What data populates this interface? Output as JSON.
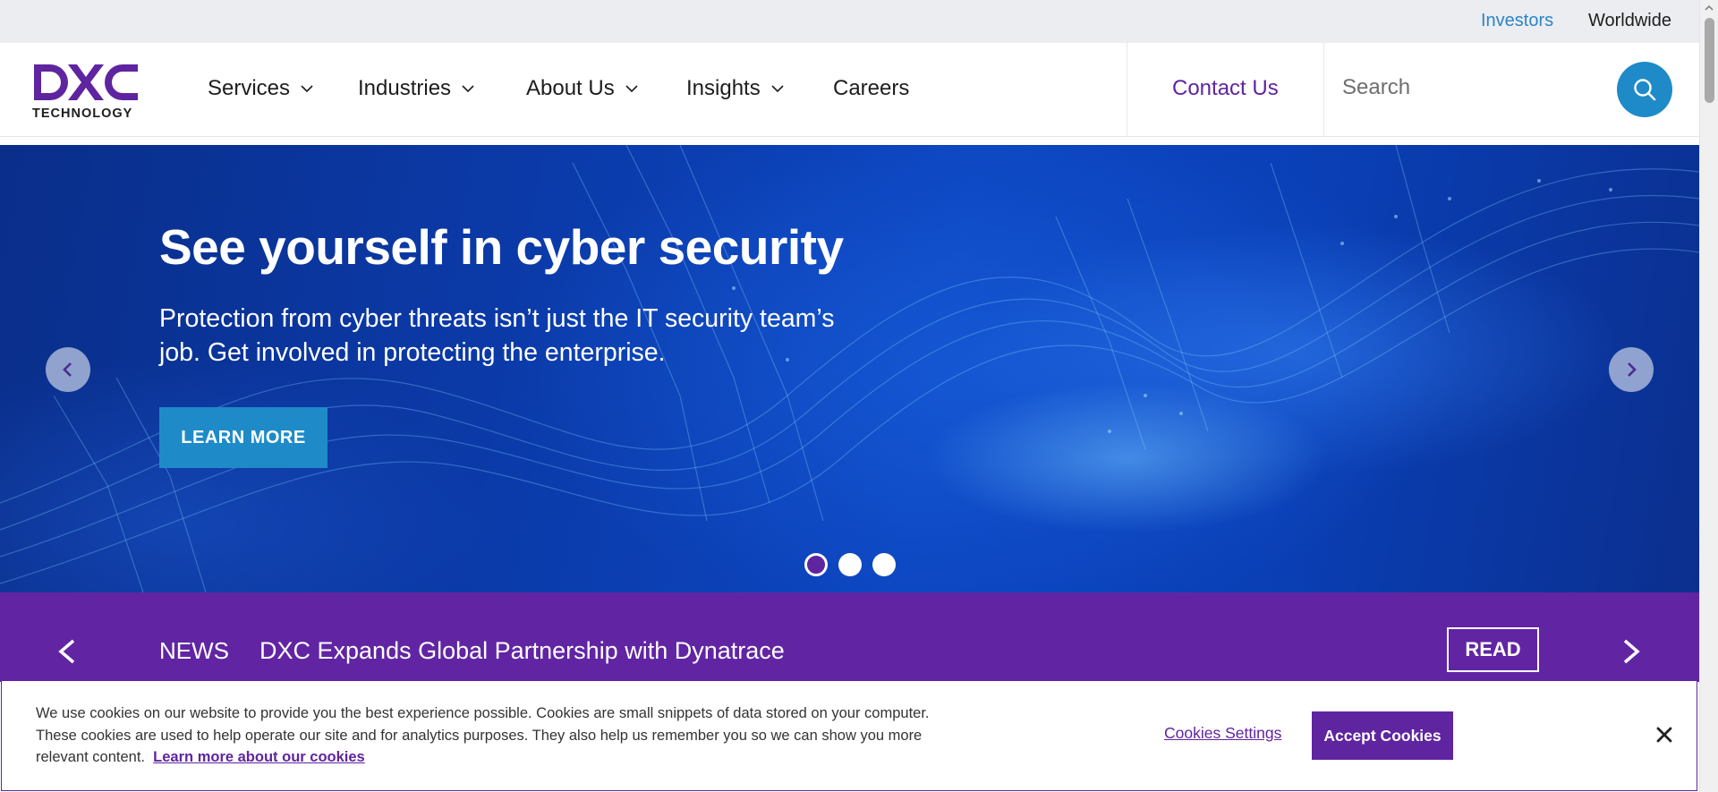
{
  "utility_bar": {
    "investors": "Investors",
    "worldwide": "Worldwide"
  },
  "header": {
    "logo_text": "TECHNOLOGY",
    "nav": [
      {
        "label": "Services",
        "has_dropdown": true
      },
      {
        "label": "Industries",
        "has_dropdown": true
      },
      {
        "label": "About Us",
        "has_dropdown": true
      },
      {
        "label": "Insights",
        "has_dropdown": true
      },
      {
        "label": "Careers",
        "has_dropdown": false
      }
    ],
    "contact": "Contact Us",
    "search": {
      "placeholder": "Search",
      "value": "",
      "icon": "search-icon"
    }
  },
  "hero": {
    "title": "See yourself in cyber security",
    "subtitle": "Protection from cyber threats isn’t just the IT security team’s job. Get involved in protecting the enterprise.",
    "cta": "LEARN MORE",
    "slides": 3,
    "active_slide": 1
  },
  "news": {
    "label": "NEWS",
    "headline": "DXC Expands Global Partnership with Dynatrace",
    "read": "READ"
  },
  "cookie_banner": {
    "text": "We use cookies on our website to provide you the best experience possible. Cookies are small snippets of data stored on your computer. These cookies are used to help operate our site and for analytics purposes. They also help us remember you so we can show you more relevant content.",
    "learn_more": "Learn more about our cookies",
    "settings": "Cookies Settings",
    "accept": "Accept Cookies"
  },
  "colors": {
    "brand_purple": "#5f249f",
    "accent_blue": "#1e8bc8",
    "news_bar": "#6125a3"
  }
}
